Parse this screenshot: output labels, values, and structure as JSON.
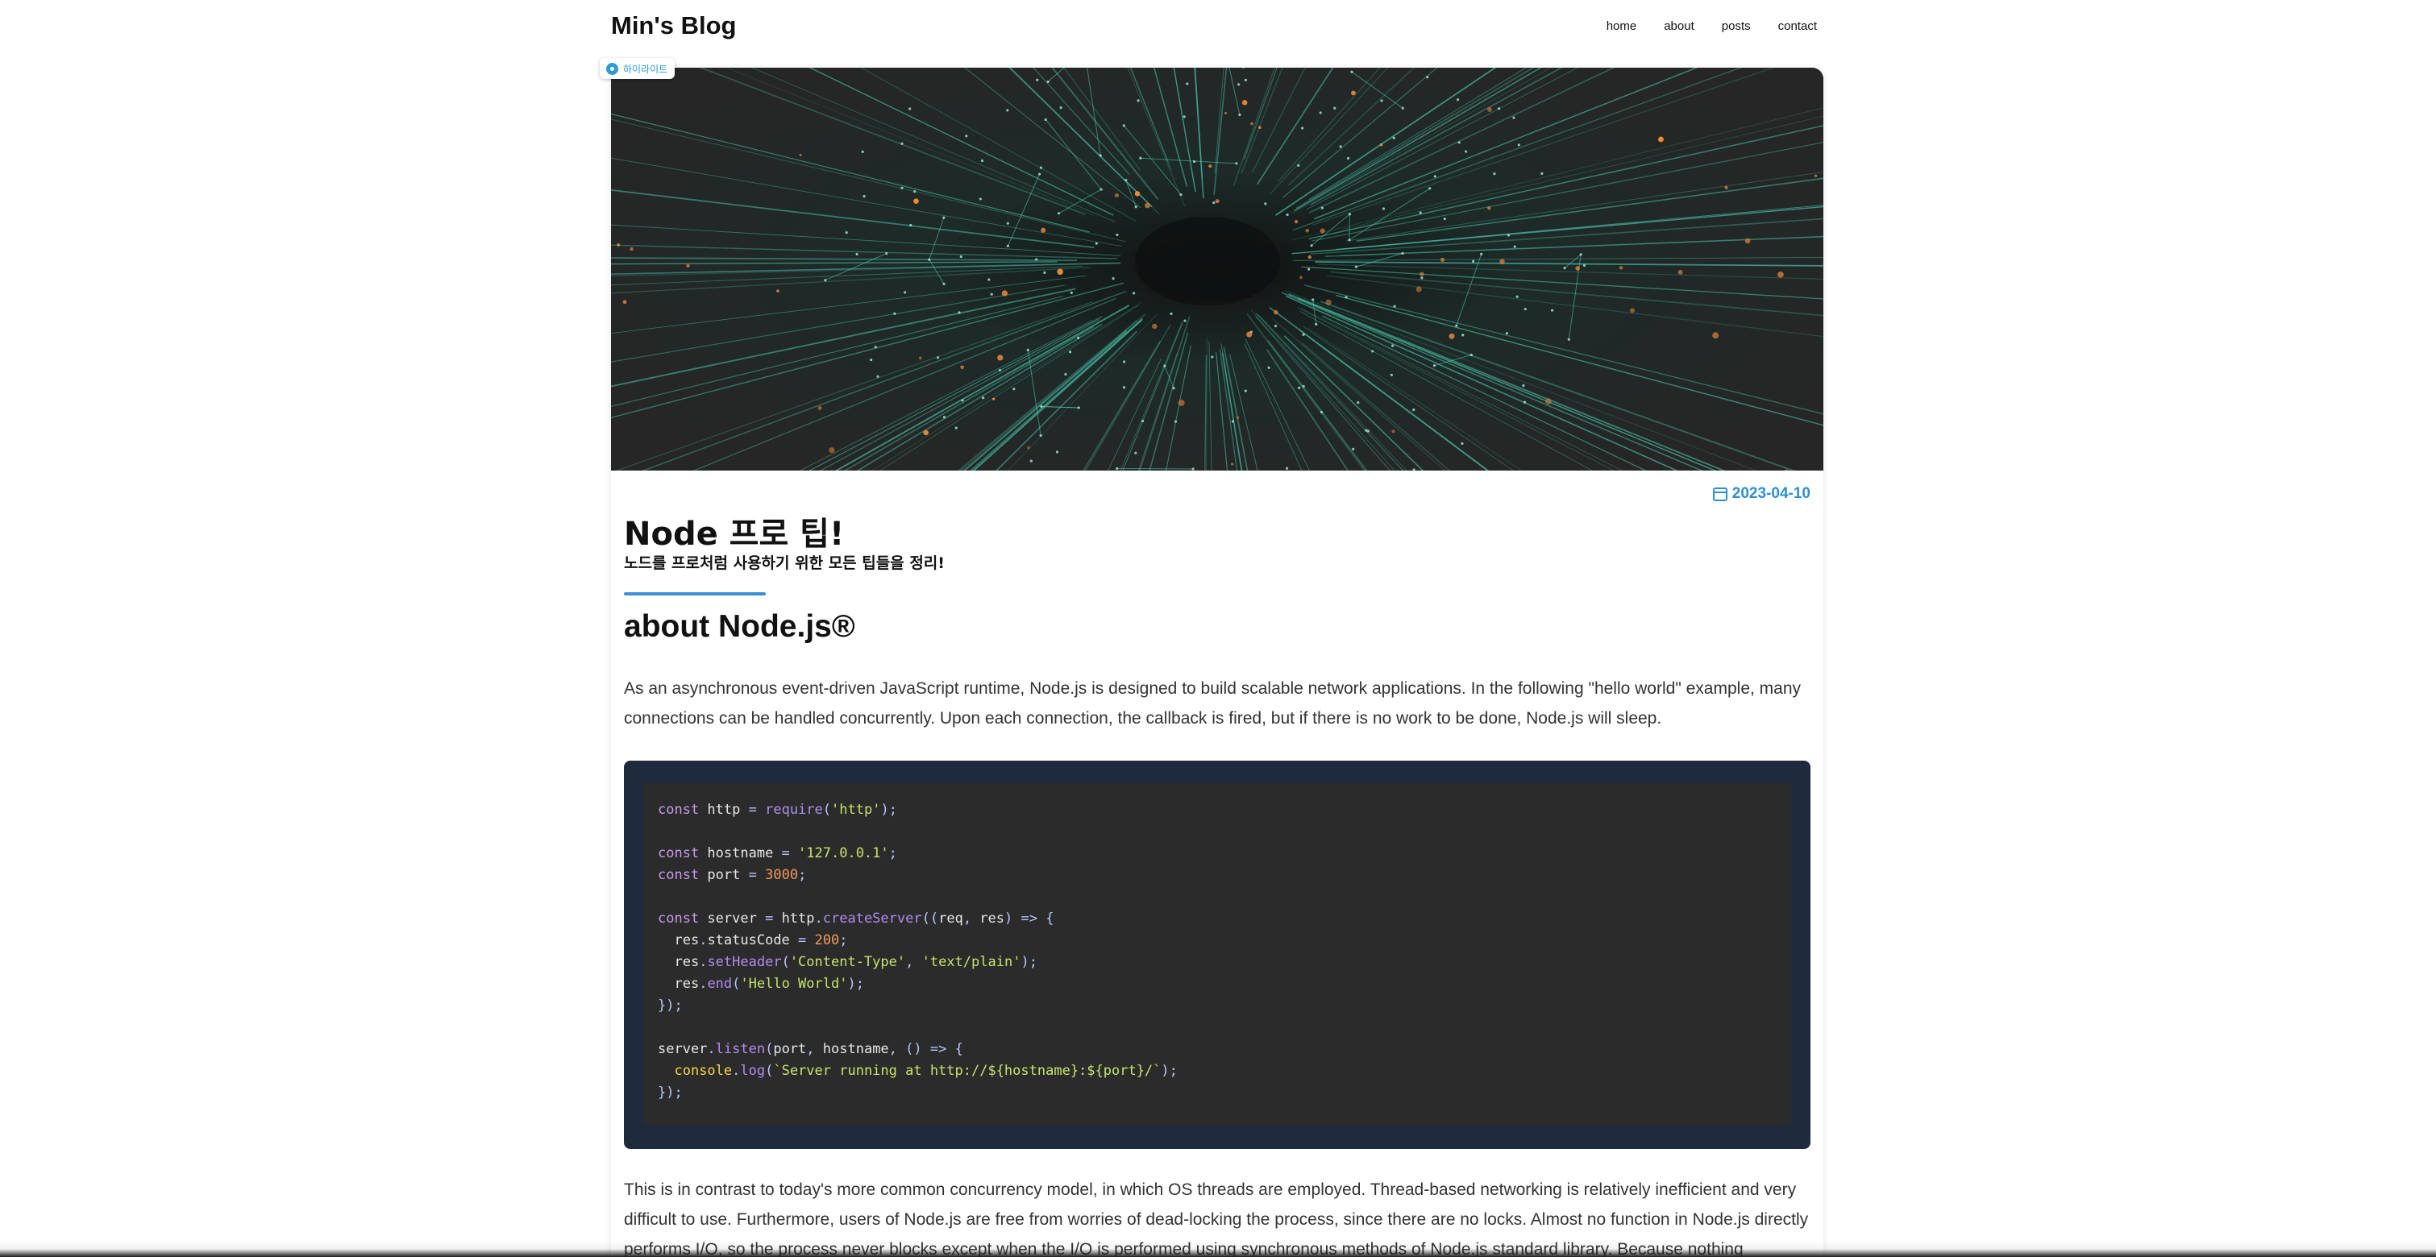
{
  "site": {
    "title": "Min's Blog"
  },
  "nav": [
    {
      "label": "home"
    },
    {
      "label": "about"
    },
    {
      "label": "posts"
    },
    {
      "label": "contact"
    }
  ],
  "highlight_badge": {
    "label": "하이라이트",
    "icon": "highlight-icon"
  },
  "post": {
    "date": "2023-04-10",
    "title": "Node 프로 팁!",
    "subtitle": "노드를 프로처럼 사용하기 위한 모든 팁들을 정리!",
    "section_heading": "about Node.js®",
    "paragraph1": "As an asynchronous event-driven JavaScript runtime, Node.js is designed to build scalable network applications. In the following \"hello world\" example, many connections can be handled concurrently. Upon each connection, the callback is fired, but if there is no work to be done, Node.js will sleep.",
    "paragraph2": "This is in contrast to today's more common concurrency model, in which OS threads are employed. Thread-based networking is relatively inefficient and very difficult to use. Furthermore, users of Node.js are free from worries of dead-locking the process, since there are no locks. Almost no function in Node.js directly performs I/O, so the process never blocks except when the I/O is performed using synchronous methods of Node.js standard library. Because nothing",
    "code_lines": [
      "const http = require('http');",
      "",
      "const hostname = '127.0.0.1';",
      "const port = 3000;",
      "",
      "const server = http.createServer((req, res) => {",
      "  res.statusCode = 200;",
      "  res.setHeader('Content-Type', 'text/plain');",
      "  res.end('Hello World');",
      "});",
      "",
      "server.listen(port, hostname, () => {",
      "  console.log(`Server running at http://${hostname}:${port}/`);",
      "});"
    ]
  },
  "colors": {
    "accent": "#2e8fd6",
    "code_background": "#2b2b2b",
    "code_frame": "#1f2a3c",
    "hero_network": "#4fd1b5",
    "hero_sparks": "#f08a3a"
  }
}
